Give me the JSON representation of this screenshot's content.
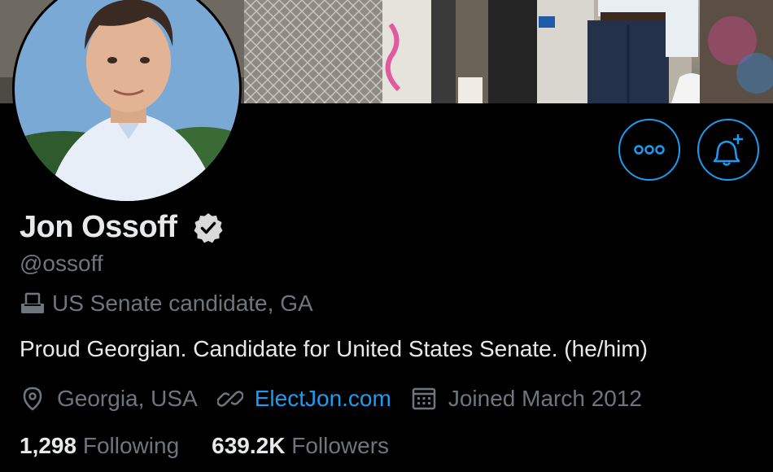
{
  "profile": {
    "name": "Jon Ossoff",
    "handle": "@ossoff",
    "label": "US Senate candidate, GA",
    "bio": "Proud Georgian. Candidate for United States Senate. (he/him)",
    "location": "Georgia, USA",
    "website": "ElectJon.com",
    "joined": "Joined March 2012",
    "following_count": "1,298",
    "following_label": "Following",
    "followers_count": "639.2K",
    "followers_label": "Followers"
  },
  "icons": {
    "more": "more-icon",
    "notify": "bell-plus-icon",
    "verified": "verified-badge-icon",
    "label": "ballot-box-icon",
    "location": "location-pin-icon",
    "link": "link-icon",
    "calendar": "calendar-icon"
  },
  "colors": {
    "accent": "#1d9bf0",
    "background": "#000000",
    "muted": "#6e767d",
    "text": "#e7e9ea"
  }
}
